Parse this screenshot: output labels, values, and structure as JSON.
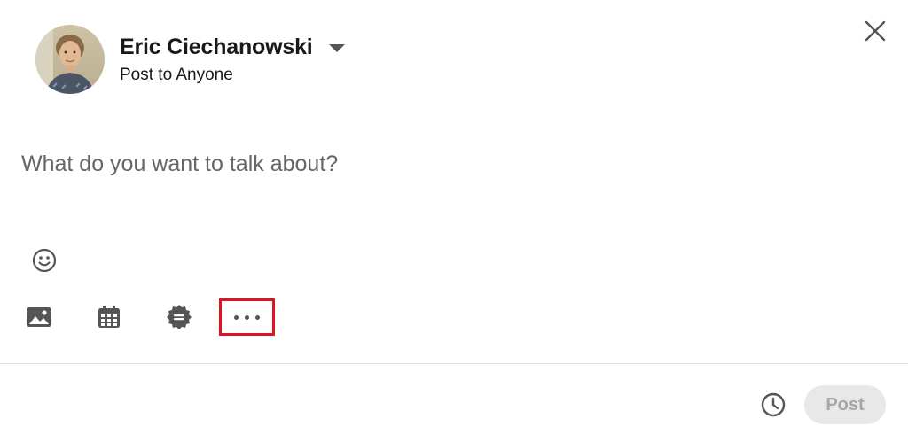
{
  "author": {
    "name": "Eric Ciechanowski",
    "visibility": "Post to Anyone"
  },
  "editor": {
    "placeholder": "What do you want to talk about?"
  },
  "toolbar": {
    "items": [
      {
        "icon": "photo-icon"
      },
      {
        "icon": "event-icon"
      },
      {
        "icon": "celebrate-icon"
      },
      {
        "icon": "more-icon",
        "highlighted": true,
        "highlight_color": "#e0141e"
      }
    ]
  },
  "footer": {
    "schedule_icon": "clock-icon",
    "post_label": "Post"
  },
  "colors": {
    "text": "#191919",
    "placeholder": "#666666",
    "icon": "#555555",
    "post_disabled_bg": "#e8e8e8",
    "post_disabled_text": "#a6a6a6"
  }
}
